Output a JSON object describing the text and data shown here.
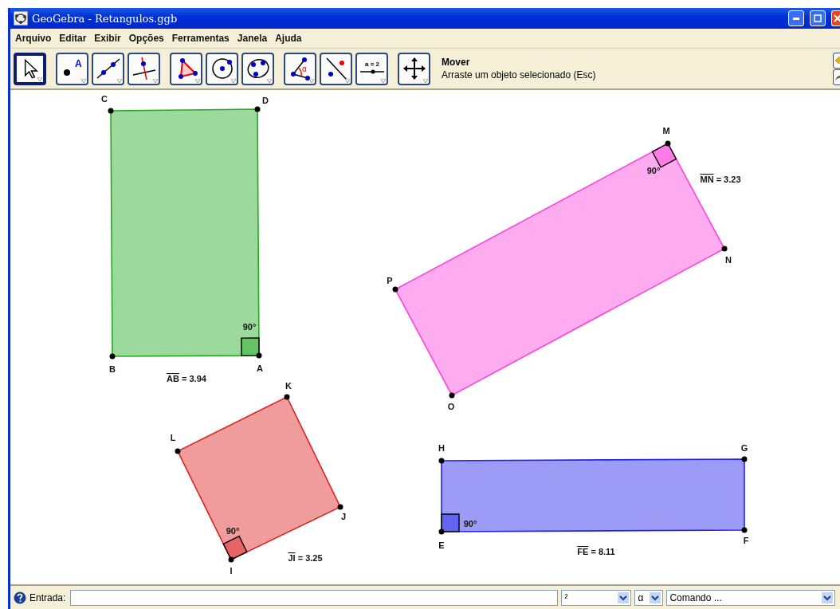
{
  "window": {
    "title": "GeoGebra - Retangulos.ggb"
  },
  "menu": [
    "Arquivo",
    "Editar",
    "Exibir",
    "Opções",
    "Ferramentas",
    "Janela",
    "Ajuda"
  ],
  "tool_groups": [
    [
      {
        "kind": "move",
        "selected": true
      }
    ],
    [
      {
        "kind": "point",
        "selected": false,
        "icon_text": "A"
      },
      {
        "kind": "line",
        "selected": false
      },
      {
        "kind": "perpendicular",
        "selected": false
      }
    ],
    [
      {
        "kind": "polygon",
        "selected": false
      },
      {
        "kind": "circle",
        "selected": false
      },
      {
        "kind": "conic",
        "selected": false
      }
    ],
    [
      {
        "kind": "angle",
        "selected": false,
        "icon_text": "α"
      },
      {
        "kind": "reflect",
        "selected": false
      },
      {
        "kind": "slider",
        "selected": false,
        "icon_text": "a = 2"
      }
    ],
    [
      {
        "kind": "move_view",
        "selected": false
      }
    ]
  ],
  "tool_info": {
    "name": "Mover",
    "help": "Arraste um objeto selecionado (Esc)"
  },
  "canvas": {
    "rectangles": [
      {
        "color": "#22aa22",
        "vertices": [
          {
            "label": "C",
            "right_angle": false
          },
          {
            "label": "D",
            "right_angle": false
          },
          {
            "label": "B",
            "right_angle": false
          },
          {
            "label": "A",
            "right_angle": true
          }
        ],
        "angle_label": "90°",
        "length": {
          "segment": "AB",
          "value": "= 3.94"
        }
      },
      {
        "color": "#ff44dd",
        "vertices": [
          {
            "label": "M",
            "right_angle": true
          },
          {
            "label": "N",
            "right_angle": false
          },
          {
            "label": "P",
            "right_angle": false
          },
          {
            "label": "O",
            "right_angle": false
          }
        ],
        "angle_label": "90°",
        "length": {
          "segment": "MN",
          "value": "= 3.23"
        }
      },
      {
        "color": "#dd2222",
        "vertices": [
          {
            "label": "K",
            "right_angle": false
          },
          {
            "label": "L",
            "right_angle": false
          },
          {
            "label": "J",
            "right_angle": false
          },
          {
            "label": "I",
            "right_angle": true
          }
        ],
        "angle_label": "90°",
        "length": {
          "segment": "JI",
          "value": "= 3.25"
        }
      },
      {
        "color": "#2222ee",
        "vertices": [
          {
            "label": "H",
            "right_angle": false
          },
          {
            "label": "G",
            "right_angle": false
          },
          {
            "label": "E",
            "right_angle": true
          },
          {
            "label": "F",
            "right_angle": false
          }
        ],
        "angle_label": "90°",
        "length": {
          "segment": "FE",
          "value": "= 8.11"
        }
      }
    ]
  },
  "input_bar": {
    "label": "Entrada:",
    "symbols": "²",
    "greek": "α",
    "command": "Comando ..."
  }
}
